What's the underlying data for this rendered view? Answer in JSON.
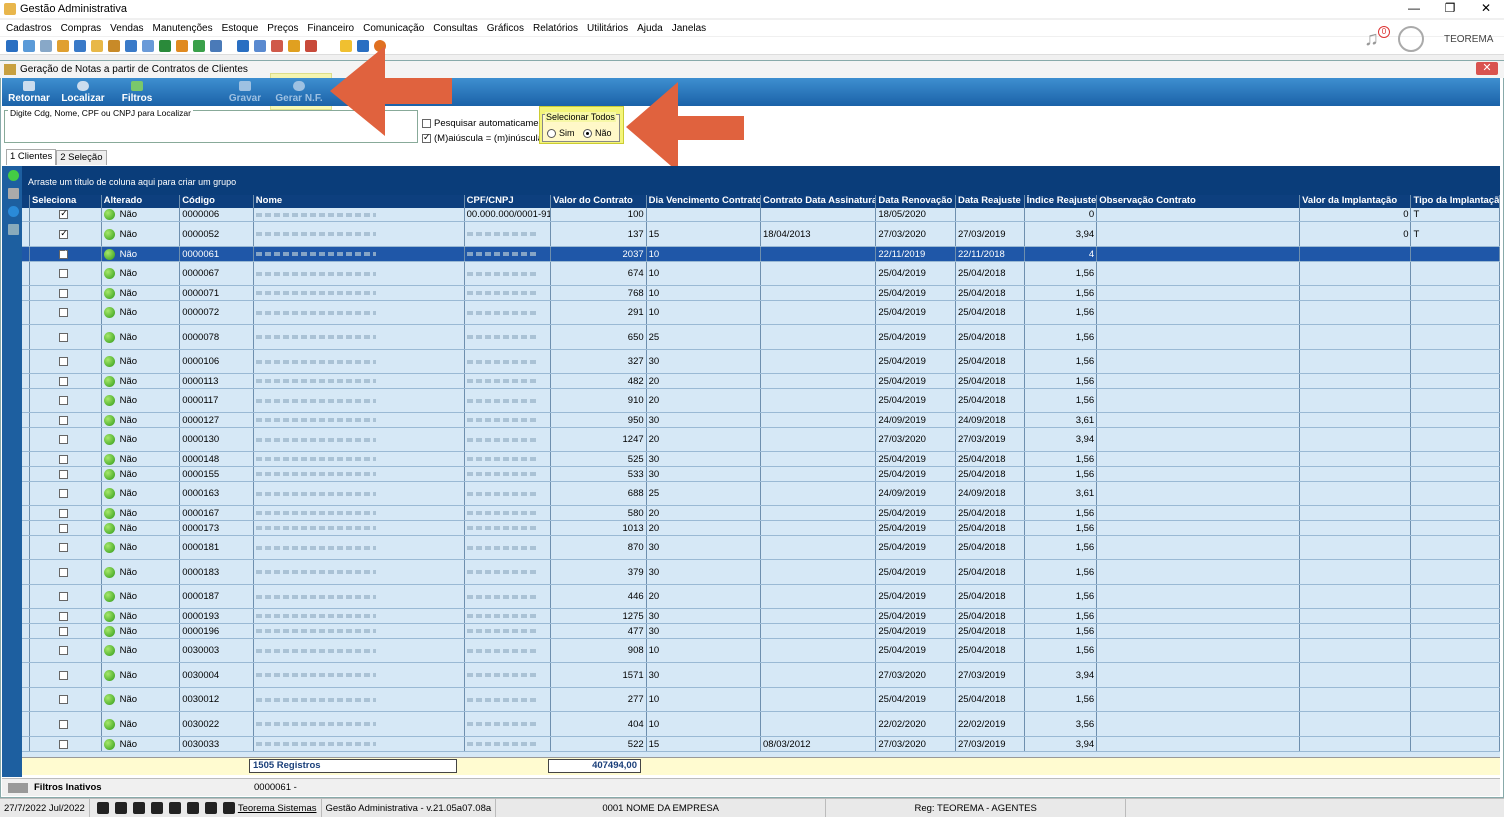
{
  "app_title": "Gestão Administrativa",
  "window_controls": [
    "—",
    "❐",
    "✕"
  ],
  "menu": [
    "Cadastros",
    "Compras",
    "Vendas",
    "Manutenções",
    "Estoque",
    "Preços",
    "Financeiro",
    "Comunicação",
    "Consultas",
    "Gráficos",
    "Relatórios",
    "Utilitários",
    "Ajuda",
    "Janelas"
  ],
  "notifications": {
    "count": "0"
  },
  "user": {
    "name": "TEOREMA"
  },
  "child": {
    "title": "Geração de Notas a partir de Contratos de Clientes",
    "close": "✕"
  },
  "actions": {
    "retornar": "Retornar",
    "localizar": "Localizar",
    "filtros": "Filtros",
    "gravar": "Gravar",
    "gerar": "Gerar N.F."
  },
  "search": {
    "label": "Digite Cdg, Nome, CPF ou CNPJ para Localizar",
    "value": "",
    "auto_label": "Pesquisar automaticamente",
    "case_label": "(M)aiúscula = (m)inúscula"
  },
  "select_all": {
    "label": "Selecionar Todos",
    "sim": "Sim",
    "nao": "Não",
    "selected": "Não"
  },
  "tabs": [
    "1 Clientes",
    "2 Seleção"
  ],
  "group_hint": "Arraste um título de coluna aqui para criar um grupo",
  "columns": [
    "Seleciona",
    "Alterado",
    "Código",
    "Nome",
    "CPF/CNPJ",
    "Valor do Contrato",
    "Dia Vencimento Contrato",
    "Contrato Data Assinatura",
    "Data Renovação",
    "Data Reajuste",
    "Índice Reajuste",
    "Observação Contrato",
    "Valor da Implantação",
    "Tipo da Implantação"
  ],
  "rows": [
    {
      "sel": true,
      "alt": "Não",
      "cod": "0000006",
      "cpf": "00.000.000/0001-91",
      "valor": "100",
      "dia": "",
      "assin": "",
      "renov": "18/05/2020",
      "reaj": "",
      "indice": "0",
      "obs": "",
      "vimp": "0",
      "timp": "T"
    },
    {
      "sel": true,
      "alt": "Não",
      "cod": "0000052",
      "cpf": "",
      "valor": "137",
      "dia": "15",
      "assin": "18/04/2013",
      "renov": "27/03/2020",
      "reaj": "27/03/2019",
      "indice": "3,94",
      "obs": "",
      "vimp": "0",
      "timp": "T"
    },
    {
      "sel": true,
      "alt": "Não",
      "cod": "0000061",
      "cpf": "",
      "valor": "2037",
      "dia": "10",
      "assin": "",
      "renov": "22/11/2019",
      "reaj": "22/11/2018",
      "indice": "4",
      "obs": "",
      "vimp": "",
      "timp": ""
    },
    {
      "sel": false,
      "alt": "Não",
      "cod": "0000067",
      "cpf": "",
      "valor": "674",
      "dia": "10",
      "assin": "",
      "renov": "25/04/2019",
      "reaj": "25/04/2018",
      "indice": "1,56",
      "obs": "",
      "vimp": "",
      "timp": ""
    },
    {
      "sel": false,
      "alt": "Não",
      "cod": "0000071",
      "cpf": "",
      "valor": "768",
      "dia": "10",
      "assin": "",
      "renov": "25/04/2019",
      "reaj": "25/04/2018",
      "indice": "1,56",
      "obs": "",
      "vimp": "",
      "timp": ""
    },
    {
      "sel": false,
      "alt": "Não",
      "cod": "0000072",
      "cpf": "",
      "valor": "291",
      "dia": "10",
      "assin": "",
      "renov": "25/04/2019",
      "reaj": "25/04/2018",
      "indice": "1,56",
      "obs": "",
      "vimp": "",
      "timp": ""
    },
    {
      "sel": false,
      "alt": "Não",
      "cod": "0000078",
      "cpf": "",
      "valor": "650",
      "dia": "25",
      "assin": "",
      "renov": "25/04/2019",
      "reaj": "25/04/2018",
      "indice": "1,56",
      "obs": "",
      "vimp": "",
      "timp": ""
    },
    {
      "sel": false,
      "alt": "Não",
      "cod": "0000106",
      "cpf": "",
      "valor": "327",
      "dia": "30",
      "assin": "",
      "renov": "25/04/2019",
      "reaj": "25/04/2018",
      "indice": "1,56",
      "obs": "",
      "vimp": "",
      "timp": ""
    },
    {
      "sel": false,
      "alt": "Não",
      "cod": "0000113",
      "cpf": "",
      "valor": "482",
      "dia": "20",
      "assin": "",
      "renov": "25/04/2019",
      "reaj": "25/04/2018",
      "indice": "1,56",
      "obs": "",
      "vimp": "",
      "timp": ""
    },
    {
      "sel": false,
      "alt": "Não",
      "cod": "0000117",
      "cpf": "",
      "valor": "910",
      "dia": "20",
      "assin": "",
      "renov": "25/04/2019",
      "reaj": "25/04/2018",
      "indice": "1,56",
      "obs": "",
      "vimp": "",
      "timp": ""
    },
    {
      "sel": false,
      "alt": "Não",
      "cod": "0000127",
      "cpf": "",
      "valor": "950",
      "dia": "30",
      "assin": "",
      "renov": "24/09/2019",
      "reaj": "24/09/2018",
      "indice": "3,61",
      "obs": "",
      "vimp": "",
      "timp": ""
    },
    {
      "sel": false,
      "alt": "Não",
      "cod": "0000130",
      "cpf": "",
      "valor": "1247",
      "dia": "20",
      "assin": "",
      "renov": "27/03/2020",
      "reaj": "27/03/2019",
      "indice": "3,94",
      "obs": "",
      "vimp": "",
      "timp": ""
    },
    {
      "sel": false,
      "alt": "Não",
      "cod": "0000148",
      "cpf": "",
      "valor": "525",
      "dia": "30",
      "assin": "",
      "renov": "25/04/2019",
      "reaj": "25/04/2018",
      "indice": "1,56",
      "obs": "",
      "vimp": "",
      "timp": ""
    },
    {
      "sel": false,
      "alt": "Não",
      "cod": "0000155",
      "cpf": "",
      "valor": "533",
      "dia": "30",
      "assin": "",
      "renov": "25/04/2019",
      "reaj": "25/04/2018",
      "indice": "1,56",
      "obs": "",
      "vimp": "",
      "timp": ""
    },
    {
      "sel": false,
      "alt": "Não",
      "cod": "0000163",
      "cpf": "",
      "valor": "688",
      "dia": "25",
      "assin": "",
      "renov": "24/09/2019",
      "reaj": "24/09/2018",
      "indice": "3,61",
      "obs": "",
      "vimp": "",
      "timp": ""
    },
    {
      "sel": false,
      "alt": "Não",
      "cod": "0000167",
      "cpf": "",
      "valor": "580",
      "dia": "20",
      "assin": "",
      "renov": "25/04/2019",
      "reaj": "25/04/2018",
      "indice": "1,56",
      "obs": "",
      "vimp": "",
      "timp": ""
    },
    {
      "sel": false,
      "alt": "Não",
      "cod": "0000173",
      "cpf": "",
      "valor": "1013",
      "dia": "20",
      "assin": "",
      "renov": "25/04/2019",
      "reaj": "25/04/2018",
      "indice": "1,56",
      "obs": "",
      "vimp": "",
      "timp": ""
    },
    {
      "sel": false,
      "alt": "Não",
      "cod": "0000181",
      "cpf": "",
      "valor": "870",
      "dia": "30",
      "assin": "",
      "renov": "25/04/2019",
      "reaj": "25/04/2018",
      "indice": "1,56",
      "obs": "",
      "vimp": "",
      "timp": ""
    },
    {
      "sel": false,
      "alt": "Não",
      "cod": "0000183",
      "cpf": "",
      "valor": "379",
      "dia": "30",
      "assin": "",
      "renov": "25/04/2019",
      "reaj": "25/04/2018",
      "indice": "1,56",
      "obs": "",
      "vimp": "",
      "timp": ""
    },
    {
      "sel": false,
      "alt": "Não",
      "cod": "0000187",
      "cpf": "",
      "valor": "446",
      "dia": "20",
      "assin": "",
      "renov": "25/04/2019",
      "reaj": "25/04/2018",
      "indice": "1,56",
      "obs": "",
      "vimp": "",
      "timp": ""
    },
    {
      "sel": false,
      "alt": "Não",
      "cod": "0000193",
      "cpf": "",
      "valor": "1275",
      "dia": "30",
      "assin": "",
      "renov": "25/04/2019",
      "reaj": "25/04/2018",
      "indice": "1,56",
      "obs": "",
      "vimp": "",
      "timp": ""
    },
    {
      "sel": false,
      "alt": "Não",
      "cod": "0000196",
      "cpf": "",
      "valor": "477",
      "dia": "30",
      "assin": "",
      "renov": "25/04/2019",
      "reaj": "25/04/2018",
      "indice": "1,56",
      "obs": "",
      "vimp": "",
      "timp": ""
    },
    {
      "sel": false,
      "alt": "Não",
      "cod": "0030003",
      "cpf": "",
      "valor": "908",
      "dia": "10",
      "assin": "",
      "renov": "25/04/2019",
      "reaj": "25/04/2018",
      "indice": "1,56",
      "obs": "",
      "vimp": "",
      "timp": ""
    },
    {
      "sel": false,
      "alt": "Não",
      "cod": "0030004",
      "cpf": "",
      "valor": "1571",
      "dia": "30",
      "assin": "",
      "renov": "27/03/2020",
      "reaj": "27/03/2019",
      "indice": "3,94",
      "obs": "",
      "vimp": "",
      "timp": ""
    },
    {
      "sel": false,
      "alt": "Não",
      "cod": "0030012",
      "cpf": "",
      "valor": "277",
      "dia": "10",
      "assin": "",
      "renov": "25/04/2019",
      "reaj": "25/04/2018",
      "indice": "1,56",
      "obs": "",
      "vimp": "",
      "timp": ""
    },
    {
      "sel": false,
      "alt": "Não",
      "cod": "0030022",
      "cpf": "",
      "valor": "404",
      "dia": "10",
      "assin": "",
      "renov": "22/02/2020",
      "reaj": "22/02/2019",
      "indice": "3,56",
      "obs": "",
      "vimp": "",
      "timp": ""
    },
    {
      "sel": false,
      "alt": "Não",
      "cod": "0030033",
      "cpf": "",
      "valor": "522",
      "dia": "15",
      "assin": "08/03/2012",
      "renov": "27/03/2020",
      "reaj": "27/03/2019",
      "indice": "3,94",
      "obs": "",
      "vimp": "",
      "timp": ""
    }
  ],
  "footer": {
    "registros": "1505 Registros",
    "total": "407494,00"
  },
  "filterbar": {
    "label": "Filtros Inativos",
    "current_code": "0000061 -"
  },
  "status": {
    "date": "27/7/2022 Jul/2022",
    "company_link": "Teorema Sistemas",
    "version": "Gestão Administrativa - v.21.05a07.08a",
    "empresa": "0001 NOME DA EMPRESA",
    "reg": "Reg: TEOREMA - AGENTES"
  },
  "colors": {
    "accent": "#1b62a8",
    "highlight": "#f4f57a",
    "arrow": "#e0623e"
  }
}
